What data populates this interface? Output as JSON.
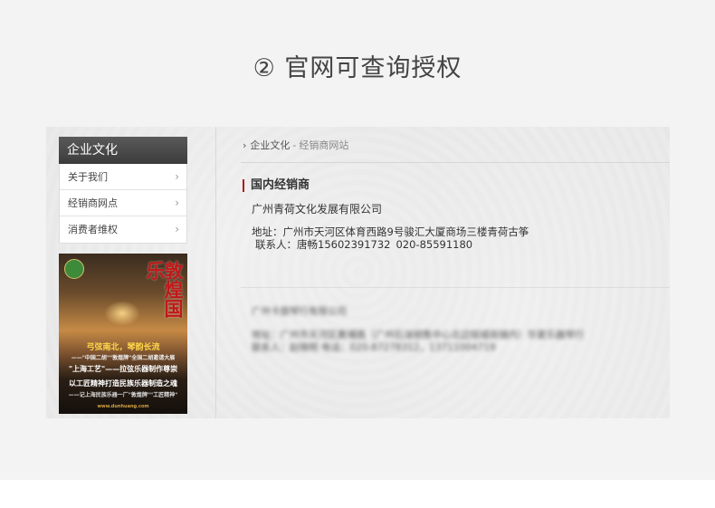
{
  "heading": "② 官网可查询授权",
  "sidebar": {
    "title": "企业文化",
    "items": [
      {
        "label": "关于我们"
      },
      {
        "label": "经销商网点"
      },
      {
        "label": "消费者维权"
      }
    ]
  },
  "magazine": {
    "title": "敦煌国乐",
    "line1": "弓弦南北，琴韵长流",
    "line2": "——\"中国二胡\"\"敦煌牌\"全国二胡邀请大展",
    "line3": "\"上海工艺\"——拉弦乐器制作尊崇",
    "line4": "以工匠精神打造民族乐器制造之魂",
    "line5": "——记上海民族乐器一厂\"敦煌牌\"\"工匠精神\"",
    "line6": "www.dunhuang.com"
  },
  "breadcrumb": {
    "gt": "›",
    "parent": "企业文化",
    "separator": "-",
    "current": "经销商网站"
  },
  "section": {
    "title": "国内经销商"
  },
  "dealer": {
    "company": "广州青荷文化发展有限公司",
    "address": "地址：广州市天河区体育西路9号骏汇大厦商场三楼青荷古筝",
    "contact": "联系人：唐畅15602391732",
    "phone": "020-85591180"
  },
  "blurred_dealer": {
    "company": "广州卡旋琴行有限公司",
    "address": "地址：广州市天河区黄埔路（广州石油销售中心北边铭城商铺内）华夏乐器琴行",
    "contact": "联系人：赵晓明  电话：020-87278312，13711004719"
  }
}
